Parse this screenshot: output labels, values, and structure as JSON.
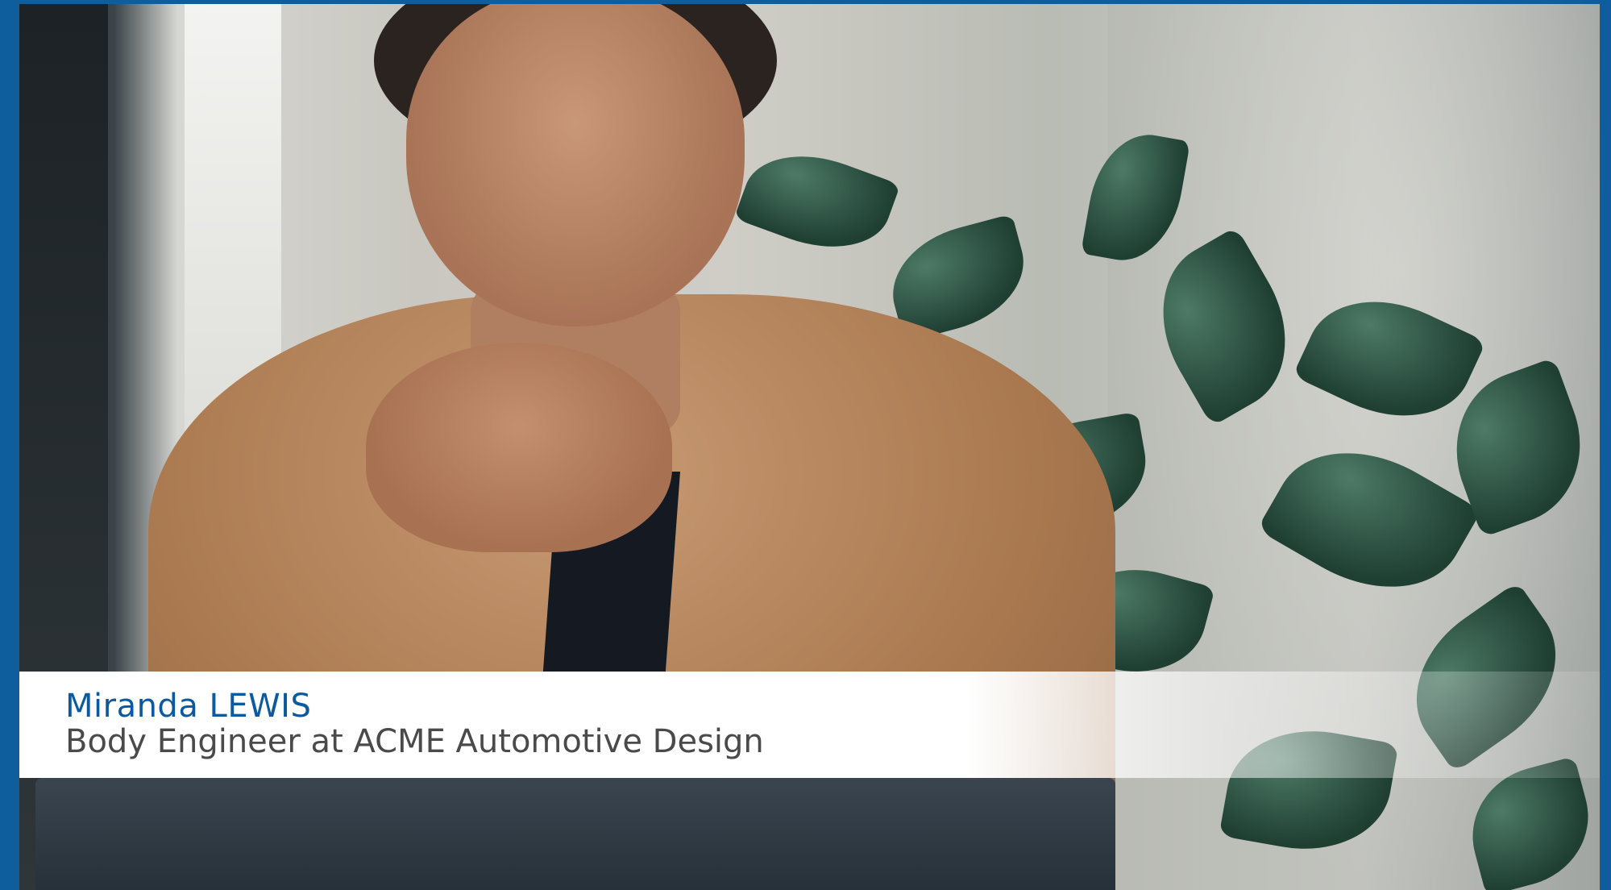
{
  "lower_third": {
    "name": "Miranda LEWIS",
    "title": "Body Engineer at ACME Automotive Design"
  },
  "colors": {
    "frame_border": "#0e5d9c",
    "name_text": "#0b5aa0",
    "title_text": "#4a4a4a",
    "banner_background": "#ffffff"
  },
  "scene": {
    "subject": "person-in-tan-shirt",
    "background": "plants-and-wall"
  }
}
